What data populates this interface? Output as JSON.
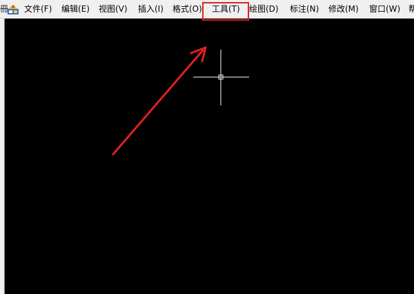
{
  "menubar": {
    "edge_glyph": "冊",
    "items": [
      {
        "label": "文件(F)"
      },
      {
        "label": "编辑(E)"
      },
      {
        "label": "视图(V)"
      },
      {
        "label": "插入(I)"
      },
      {
        "label": "格式(O)"
      },
      {
        "label": "工具(T)"
      },
      {
        "label": "绘图(D)"
      },
      {
        "label": "标注(N)"
      },
      {
        "label": "修改(M)"
      },
      {
        "label": "窗口(W)"
      },
      {
        "label": "帮"
      }
    ],
    "highlighted_item": "工具(T)"
  },
  "colors": {
    "menubar_bg": "#f0f0f0",
    "canvas_bg": "#000000",
    "annotation": "#e02020",
    "crosshair": "#ffffff"
  },
  "icons": {
    "app": "app-logo-icon",
    "cursor": "crosshair-cursor-icon",
    "annotation": "red-arrow-annotation"
  }
}
